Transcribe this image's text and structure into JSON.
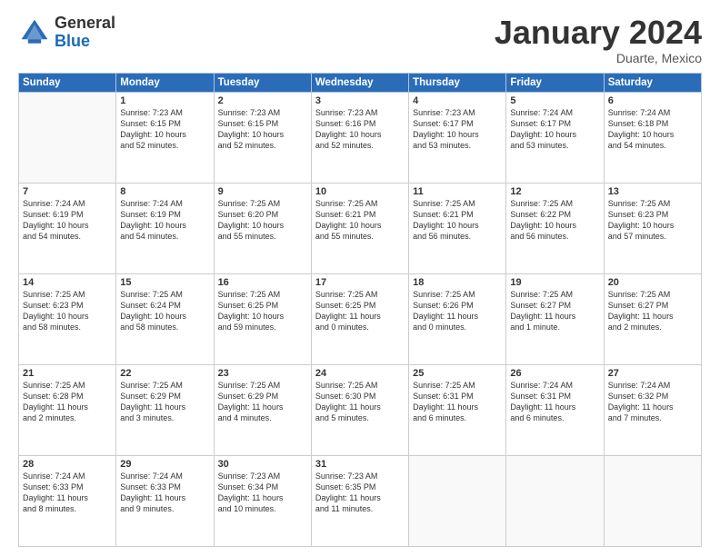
{
  "logo": {
    "general": "General",
    "blue": "Blue"
  },
  "header": {
    "month": "January 2024",
    "location": "Duarte, Mexico"
  },
  "weekdays": [
    "Sunday",
    "Monday",
    "Tuesday",
    "Wednesday",
    "Thursday",
    "Friday",
    "Saturday"
  ],
  "weeks": [
    [
      {
        "day": "",
        "info": ""
      },
      {
        "day": "1",
        "info": "Sunrise: 7:23 AM\nSunset: 6:15 PM\nDaylight: 10 hours\nand 52 minutes."
      },
      {
        "day": "2",
        "info": "Sunrise: 7:23 AM\nSunset: 6:15 PM\nDaylight: 10 hours\nand 52 minutes."
      },
      {
        "day": "3",
        "info": "Sunrise: 7:23 AM\nSunset: 6:16 PM\nDaylight: 10 hours\nand 52 minutes."
      },
      {
        "day": "4",
        "info": "Sunrise: 7:23 AM\nSunset: 6:17 PM\nDaylight: 10 hours\nand 53 minutes."
      },
      {
        "day": "5",
        "info": "Sunrise: 7:24 AM\nSunset: 6:17 PM\nDaylight: 10 hours\nand 53 minutes."
      },
      {
        "day": "6",
        "info": "Sunrise: 7:24 AM\nSunset: 6:18 PM\nDaylight: 10 hours\nand 54 minutes."
      }
    ],
    [
      {
        "day": "7",
        "info": "Sunrise: 7:24 AM\nSunset: 6:19 PM\nDaylight: 10 hours\nand 54 minutes."
      },
      {
        "day": "8",
        "info": "Sunrise: 7:24 AM\nSunset: 6:19 PM\nDaylight: 10 hours\nand 54 minutes."
      },
      {
        "day": "9",
        "info": "Sunrise: 7:25 AM\nSunset: 6:20 PM\nDaylight: 10 hours\nand 55 minutes."
      },
      {
        "day": "10",
        "info": "Sunrise: 7:25 AM\nSunset: 6:21 PM\nDaylight: 10 hours\nand 55 minutes."
      },
      {
        "day": "11",
        "info": "Sunrise: 7:25 AM\nSunset: 6:21 PM\nDaylight: 10 hours\nand 56 minutes."
      },
      {
        "day": "12",
        "info": "Sunrise: 7:25 AM\nSunset: 6:22 PM\nDaylight: 10 hours\nand 56 minutes."
      },
      {
        "day": "13",
        "info": "Sunrise: 7:25 AM\nSunset: 6:23 PM\nDaylight: 10 hours\nand 57 minutes."
      }
    ],
    [
      {
        "day": "14",
        "info": "Sunrise: 7:25 AM\nSunset: 6:23 PM\nDaylight: 10 hours\nand 58 minutes."
      },
      {
        "day": "15",
        "info": "Sunrise: 7:25 AM\nSunset: 6:24 PM\nDaylight: 10 hours\nand 58 minutes."
      },
      {
        "day": "16",
        "info": "Sunrise: 7:25 AM\nSunset: 6:25 PM\nDaylight: 10 hours\nand 59 minutes."
      },
      {
        "day": "17",
        "info": "Sunrise: 7:25 AM\nSunset: 6:25 PM\nDaylight: 11 hours\nand 0 minutes."
      },
      {
        "day": "18",
        "info": "Sunrise: 7:25 AM\nSunset: 6:26 PM\nDaylight: 11 hours\nand 0 minutes."
      },
      {
        "day": "19",
        "info": "Sunrise: 7:25 AM\nSunset: 6:27 PM\nDaylight: 11 hours\nand 1 minute."
      },
      {
        "day": "20",
        "info": "Sunrise: 7:25 AM\nSunset: 6:27 PM\nDaylight: 11 hours\nand 2 minutes."
      }
    ],
    [
      {
        "day": "21",
        "info": "Sunrise: 7:25 AM\nSunset: 6:28 PM\nDaylight: 11 hours\nand 2 minutes."
      },
      {
        "day": "22",
        "info": "Sunrise: 7:25 AM\nSunset: 6:29 PM\nDaylight: 11 hours\nand 3 minutes."
      },
      {
        "day": "23",
        "info": "Sunrise: 7:25 AM\nSunset: 6:29 PM\nDaylight: 11 hours\nand 4 minutes."
      },
      {
        "day": "24",
        "info": "Sunrise: 7:25 AM\nSunset: 6:30 PM\nDaylight: 11 hours\nand 5 minutes."
      },
      {
        "day": "25",
        "info": "Sunrise: 7:25 AM\nSunset: 6:31 PM\nDaylight: 11 hours\nand 6 minutes."
      },
      {
        "day": "26",
        "info": "Sunrise: 7:24 AM\nSunset: 6:31 PM\nDaylight: 11 hours\nand 6 minutes."
      },
      {
        "day": "27",
        "info": "Sunrise: 7:24 AM\nSunset: 6:32 PM\nDaylight: 11 hours\nand 7 minutes."
      }
    ],
    [
      {
        "day": "28",
        "info": "Sunrise: 7:24 AM\nSunset: 6:33 PM\nDaylight: 11 hours\nand 8 minutes."
      },
      {
        "day": "29",
        "info": "Sunrise: 7:24 AM\nSunset: 6:33 PM\nDaylight: 11 hours\nand 9 minutes."
      },
      {
        "day": "30",
        "info": "Sunrise: 7:23 AM\nSunset: 6:34 PM\nDaylight: 11 hours\nand 10 minutes."
      },
      {
        "day": "31",
        "info": "Sunrise: 7:23 AM\nSunset: 6:35 PM\nDaylight: 11 hours\nand 11 minutes."
      },
      {
        "day": "",
        "info": ""
      },
      {
        "day": "",
        "info": ""
      },
      {
        "day": "",
        "info": ""
      }
    ]
  ]
}
